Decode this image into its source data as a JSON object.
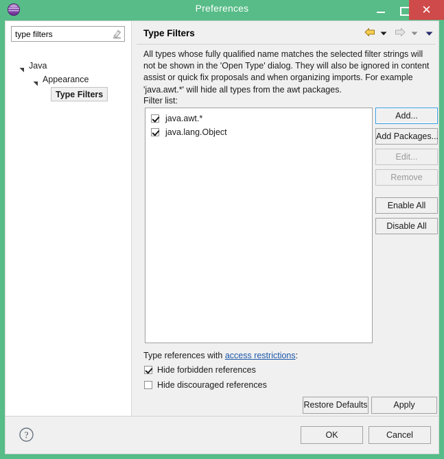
{
  "window": {
    "title": "Preferences",
    "app_icon": "eclipse-sphere-icon",
    "accent_color": "#57bc87",
    "close_button_color": "#cf4a4a",
    "controls": {
      "minimize": "minimize-icon",
      "maximize": "maximize-icon",
      "close": "✕"
    }
  },
  "sidebar": {
    "filter": {
      "value": "type filters",
      "placeholder": "type filter text",
      "clear_icon": "clear-filter-icon"
    },
    "tree": [
      {
        "label": "Java",
        "depth": 0,
        "expanded": true,
        "selected": false
      },
      {
        "label": "Appearance",
        "depth": 1,
        "expanded": true,
        "selected": false
      },
      {
        "label": "Type Filters",
        "depth": 2,
        "expanded": false,
        "selected": true
      }
    ]
  },
  "panel": {
    "title": "Type Filters",
    "nav": {
      "back_icon": "back-arrow-icon",
      "back_menu_icon": "chevron-down-icon",
      "forward_icon": "forward-arrow-icon",
      "forward_menu_icon": "chevron-down-icon",
      "view_menu_icon": "chevron-down-icon"
    },
    "description": "All types whose fully qualified name matches the selected filter strings will not be shown in the 'Open Type' dialog. They will also be ignored in content assist or quick fix proposals and when organizing imports. For example 'java.awt.*' will hide all types from the awt packages.",
    "filter_list_label": "Filter list:",
    "filter_list": [
      {
        "label": "java.awt.*",
        "checked": true
      },
      {
        "label": "java.lang.Object",
        "checked": true
      }
    ],
    "buttons": {
      "add": "Add...",
      "add_packages": "Add Packages...",
      "edit": "Edit...",
      "remove": "Remove",
      "enable_all": "Enable All",
      "disable_all": "Disable All"
    },
    "references": {
      "label_prefix": "Type references with ",
      "link": "access restrictions",
      "label_suffix": ":",
      "options": [
        {
          "label": "Hide forbidden references",
          "checked": true
        },
        {
          "label": "Hide discouraged references",
          "checked": false
        }
      ]
    },
    "restore_defaults": "Restore Defaults",
    "apply": "Apply"
  },
  "footer": {
    "help_icon": "help-question-icon",
    "ok": "OK",
    "cancel": "Cancel"
  }
}
